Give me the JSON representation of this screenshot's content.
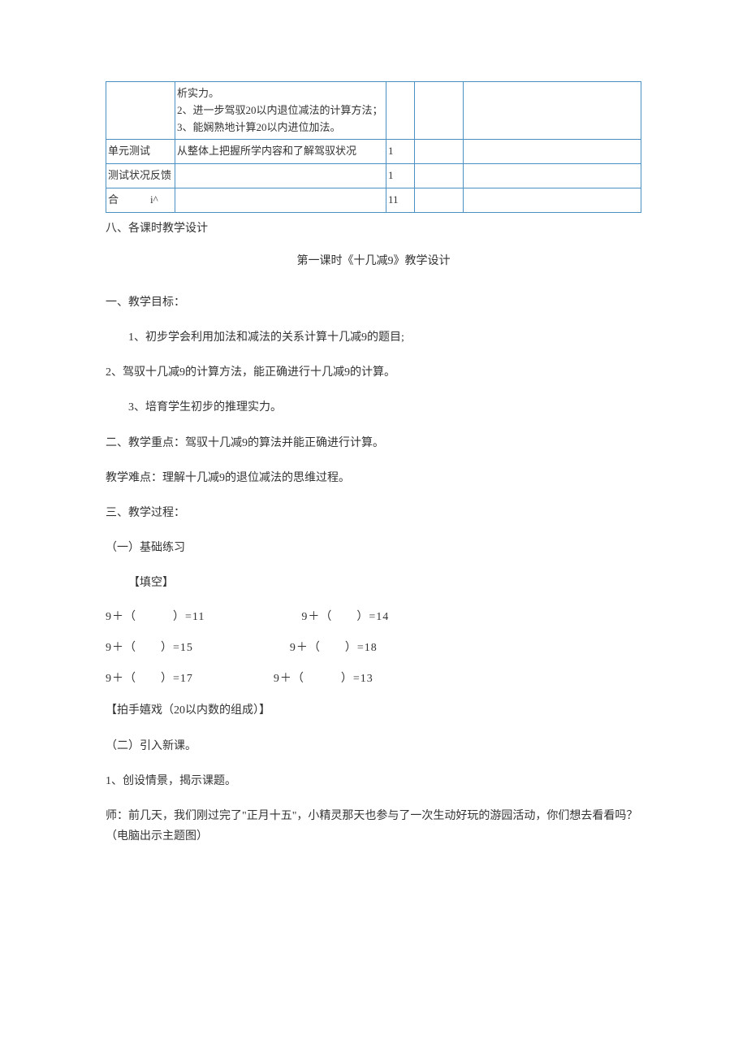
{
  "table": {
    "rows": [
      {
        "c1": "",
        "c2": "析实力。\n2、进一步驾驭20以内退位减法的计算方法；\n3、能娴熟地计算20以内进位加法。",
        "c3": "",
        "c4": "",
        "c5": ""
      },
      {
        "c1": "单元测试",
        "c2": "从整体上把握所学内容和了解驾驭状况",
        "c3": "1",
        "c4": "",
        "c5": ""
      },
      {
        "c1": "测试状况反馈",
        "c2": "",
        "c3": "1",
        "c4": "",
        "c5": ""
      },
      {
        "c1": "合　　　i^",
        "c2": "",
        "c3": "11",
        "c4": "",
        "c5": ""
      }
    ]
  },
  "sec8_heading": "八、各课时教学设计",
  "lesson_title": "第一课时《十几减9》教学设计",
  "h_objectives": "一、教学目标：",
  "obj1": "1、初步学会利用加法和减法的关系计算十几减9的题目;",
  "obj2": "2、驾驭十几减9的计算方法，能正确进行十几减9的计算。",
  "obj3": "3、培育学生初步的推理实力。",
  "h_focus": "二、教学重点：驾驭十几减9的算法并能正确进行计算。",
  "h_difficulty": "教学难点：理解十几减9的退位减法的思维过程。",
  "h_process": "三、教学过程：",
  "step1": "（一）基础练习",
  "fill_label": "【填空】",
  "equations": [
    {
      "left": "9＋（　　　）=11",
      "right": "9＋（　　）=14"
    },
    {
      "left": "9＋（　　）=15",
      "right": "9＋（　　）=18"
    },
    {
      "left": "9＋（　　）=17",
      "right": "9＋（　　　）=13"
    }
  ],
  "clap_label": "【拍手嬉戏（20以内数的组成）】",
  "step2": "（二）引入新课。",
  "scene_label": "1、创设情景，揭示课题。",
  "teacher_talk": "师：前几天，我们刚过完了\"正月十五\"，小精灵那天也参与了一次生动好玩的游园活动，你们想去看看吗？（电脑出示主题图）"
}
